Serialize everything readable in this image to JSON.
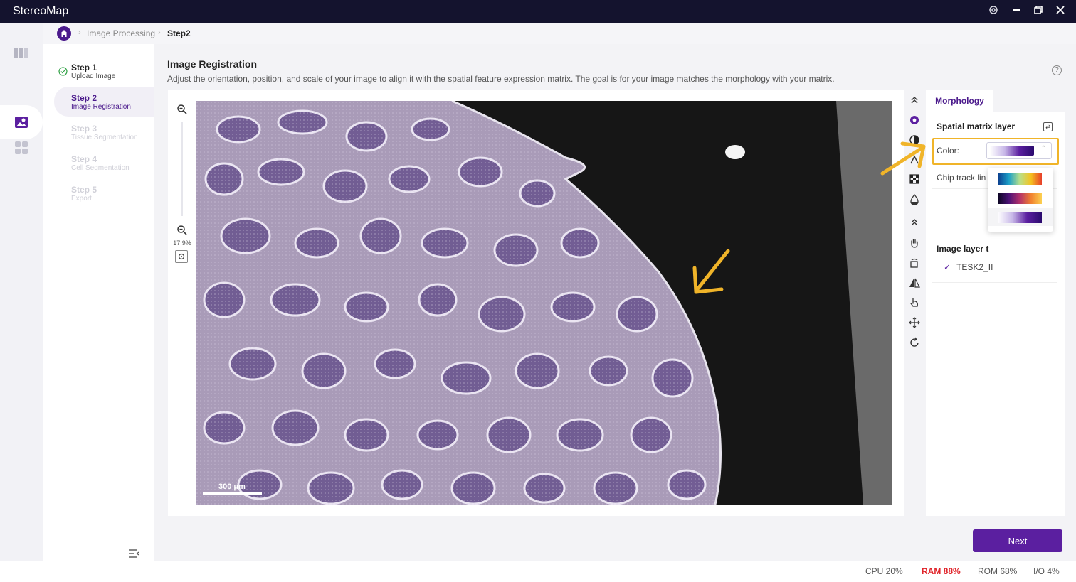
{
  "app": {
    "title": "StereoMap"
  },
  "breadcrumb": {
    "items": [
      "Image Processing",
      "Step2"
    ]
  },
  "steps": [
    {
      "title": "Step 1",
      "subtitle": "Upload Image",
      "state": "done"
    },
    {
      "title": "Step 2",
      "subtitle": "Image Registration",
      "state": "active"
    },
    {
      "title": "Step 3",
      "subtitle": "Tissue Segmentation",
      "state": "pending"
    },
    {
      "title": "Step 4",
      "subtitle": "Cell Segmentation",
      "state": "pending"
    },
    {
      "title": "Step 5",
      "subtitle": "Export",
      "state": "pending"
    }
  ],
  "main": {
    "title": "Image Registration",
    "description": "Adjust the orientation, position, and scale of your image to align it with the spatial feature expression matrix. The goal is for your image matches the morphology with your matrix."
  },
  "viewer": {
    "zoom": "17.9%",
    "scale_label": "300 μm"
  },
  "panel": {
    "tab": "Morphology",
    "spatial_section": "Spatial matrix layer",
    "color_label": "Color:",
    "chip_label": "Chip track lin",
    "image_section": "Image layer t",
    "image_item": "TESK2_II"
  },
  "colors": {
    "accent": "#5b1fa0",
    "highlight": "#f0b429"
  },
  "actions": {
    "next": "Next"
  },
  "status": {
    "cpu": "CPU  20%",
    "ram": "RAM  88%",
    "rom": "ROM  68%",
    "io": "I/O  4%"
  }
}
